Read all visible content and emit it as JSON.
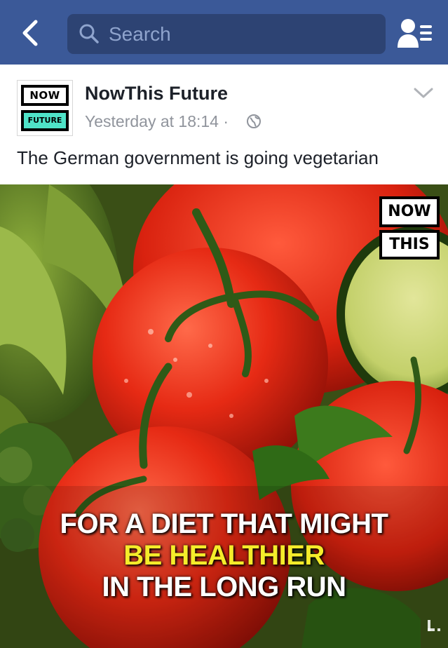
{
  "navbar": {
    "back_icon": "chevron-left-icon",
    "search_icon": "search-icon",
    "search_placeholder": "Search",
    "friends_icon": "friend-requests-icon",
    "color": "#3b5998"
  },
  "post": {
    "avatar": {
      "line1": "NOW",
      "line2": "FUTURE"
    },
    "page_name": "NowThis Future",
    "timestamp": "Yesterday at 18:14 ·",
    "privacy_icon": "globe-icon",
    "menu_icon": "chevron-down-icon",
    "text": "The German government is going vegetarian"
  },
  "video": {
    "logo_line1": "NOW",
    "logo_line2": "THIS",
    "caption_line1": "FOR A DIET THAT MIGHT",
    "caption_line2": "BE HEALTHIER",
    "caption_line3": "IN THE LONG RUN",
    "caption_highlight_color": "#f5ec2a"
  }
}
